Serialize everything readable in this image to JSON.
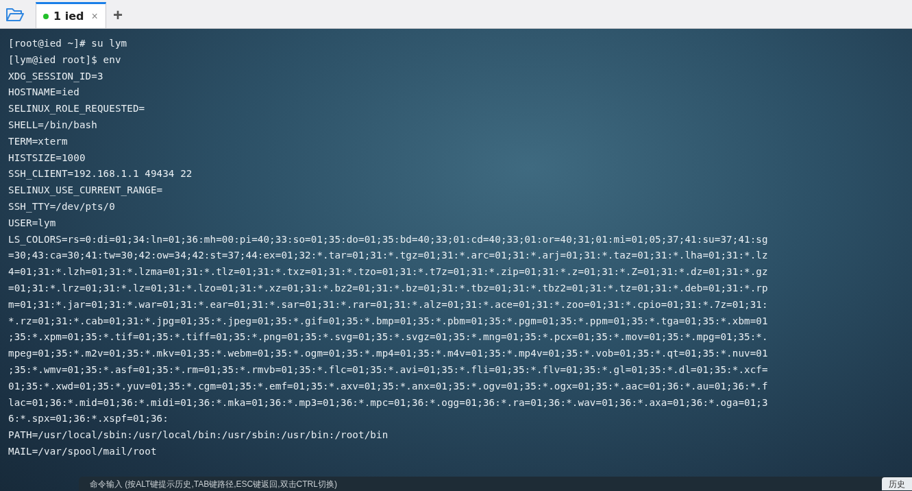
{
  "tabs": [
    {
      "number": "1",
      "label": "ied",
      "connected": true,
      "selected": true,
      "close": "×"
    }
  ],
  "new_tab": "+",
  "terminal_lines": [
    "[root@ied ~]# su lym",
    "[lym@ied root]$ env",
    "XDG_SESSION_ID=3",
    "HOSTNAME=ied",
    "SELINUX_ROLE_REQUESTED=",
    "SHELL=/bin/bash",
    "TERM=xterm",
    "HISTSIZE=1000",
    "SSH_CLIENT=192.168.1.1 49434 22",
    "SELINUX_USE_CURRENT_RANGE=",
    "SSH_TTY=/dev/pts/0",
    "USER=lym",
    "LS_COLORS=rs=0:di=01;34:ln=01;36:mh=00:pi=40;33:so=01;35:do=01;35:bd=40;33;01:cd=40;33;01:or=40;31;01:mi=01;05;37;41:su=37;41:sg",
    "=30;43:ca=30;41:tw=30;42:ow=34;42:st=37;44:ex=01;32:*.tar=01;31:*.tgz=01;31:*.arc=01;31:*.arj=01;31:*.taz=01;31:*.lha=01;31:*.lz",
    "4=01;31:*.lzh=01;31:*.lzma=01;31:*.tlz=01;31:*.txz=01;31:*.tzo=01;31:*.t7z=01;31:*.zip=01;31:*.z=01;31:*.Z=01;31:*.dz=01;31:*.gz",
    "=01;31:*.lrz=01;31:*.lz=01;31:*.lzo=01;31:*.xz=01;31:*.bz2=01;31:*.bz=01;31:*.tbz=01;31:*.tbz2=01;31:*.tz=01;31:*.deb=01;31:*.rp",
    "m=01;31:*.jar=01;31:*.war=01;31:*.ear=01;31:*.sar=01;31:*.rar=01;31:*.alz=01;31:*.ace=01;31:*.zoo=01;31:*.cpio=01;31:*.7z=01;31:",
    "*.rz=01;31:*.cab=01;31:*.jpg=01;35:*.jpeg=01;35:*.gif=01;35:*.bmp=01;35:*.pbm=01;35:*.pgm=01;35:*.ppm=01;35:*.tga=01;35:*.xbm=01",
    ";35:*.xpm=01;35:*.tif=01;35:*.tiff=01;35:*.png=01;35:*.svg=01;35:*.svgz=01;35:*.mng=01;35:*.pcx=01;35:*.mov=01;35:*.mpg=01;35:*.",
    "mpeg=01;35:*.m2v=01;35:*.mkv=01;35:*.webm=01;35:*.ogm=01;35:*.mp4=01;35:*.m4v=01;35:*.mp4v=01;35:*.vob=01;35:*.qt=01;35:*.nuv=01",
    ";35:*.wmv=01;35:*.asf=01;35:*.rm=01;35:*.rmvb=01;35:*.flc=01;35:*.avi=01;35:*.fli=01;35:*.flv=01;35:*.gl=01;35:*.dl=01;35:*.xcf=",
    "01;35:*.xwd=01;35:*.yuv=01;35:*.cgm=01;35:*.emf=01;35:*.axv=01;35:*.anx=01;35:*.ogv=01;35:*.ogx=01;35:*.aac=01;36:*.au=01;36:*.f",
    "lac=01;36:*.mid=01;36:*.midi=01;36:*.mka=01;36:*.mp3=01;36:*.mpc=01;36:*.ogg=01;36:*.ra=01;36:*.wav=01;36:*.axa=01;36:*.oga=01;3",
    "6:*.spx=01;36:*.xspf=01;36:",
    "PATH=/usr/local/sbin:/usr/local/bin:/usr/sbin:/usr/bin:/root/bin",
    "MAIL=/var/spool/mail/root"
  ],
  "command_input": {
    "placeholder": "命令输入 (按ALT键提示历史,TAB键路径,ESC键返回,双击CTRL切换)"
  },
  "history_button": "历史"
}
